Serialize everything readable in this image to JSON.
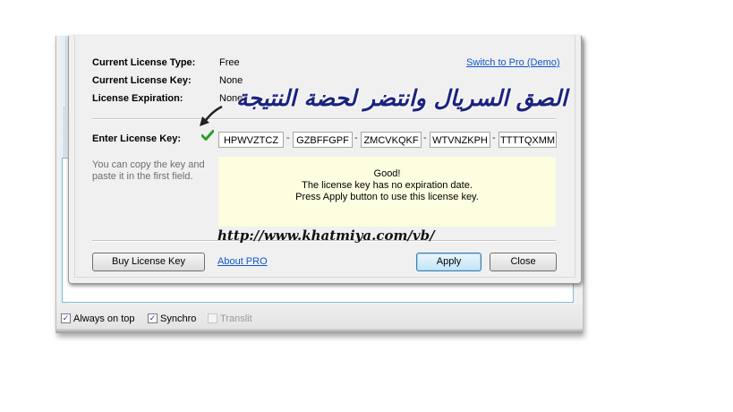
{
  "dialog": {
    "license_type_label": "Current License Type:",
    "license_type_value": "Free",
    "switch_link": "Switch to Pro (Demo)",
    "license_key_label": "Current License Key:",
    "license_key_value": "None",
    "expiration_label": "License Expiration:",
    "expiration_value": "None",
    "enter_key_label": "Enter License Key:",
    "key_fields": [
      "HPWVZTCZ",
      "GZBFFGPF",
      "ZMCVKQKF",
      "WTVNZKPH",
      "TTTTQXMM"
    ],
    "hint_text_line1": "You can copy the key and",
    "hint_text_line2": "paste it in the first field.",
    "result_line1": "Good!",
    "result_line2": "The license key has no expiration date.",
    "result_line3": "Press Apply button to use this license key.",
    "buy_button": "Buy License Key",
    "about_link": "About PRO",
    "apply_button": "Apply",
    "close_button": "Close"
  },
  "overlay": {
    "arabic_caption": "الصق السريال وانتضر لحضة النتيجة",
    "url_watermark": "http://www.khatmiya.com/vb/"
  },
  "statusbar": {
    "always_on_top": "Always on top",
    "always_on_top_checked": true,
    "synchro": "Synchro",
    "synchro_checked": true,
    "translit": "Translit",
    "translit_checked": false
  },
  "colors": {
    "link": "#1155cc",
    "result_bg": "#fdfde0",
    "checkmark": "#2e9b2e",
    "arabic_text": "#1a237e"
  }
}
